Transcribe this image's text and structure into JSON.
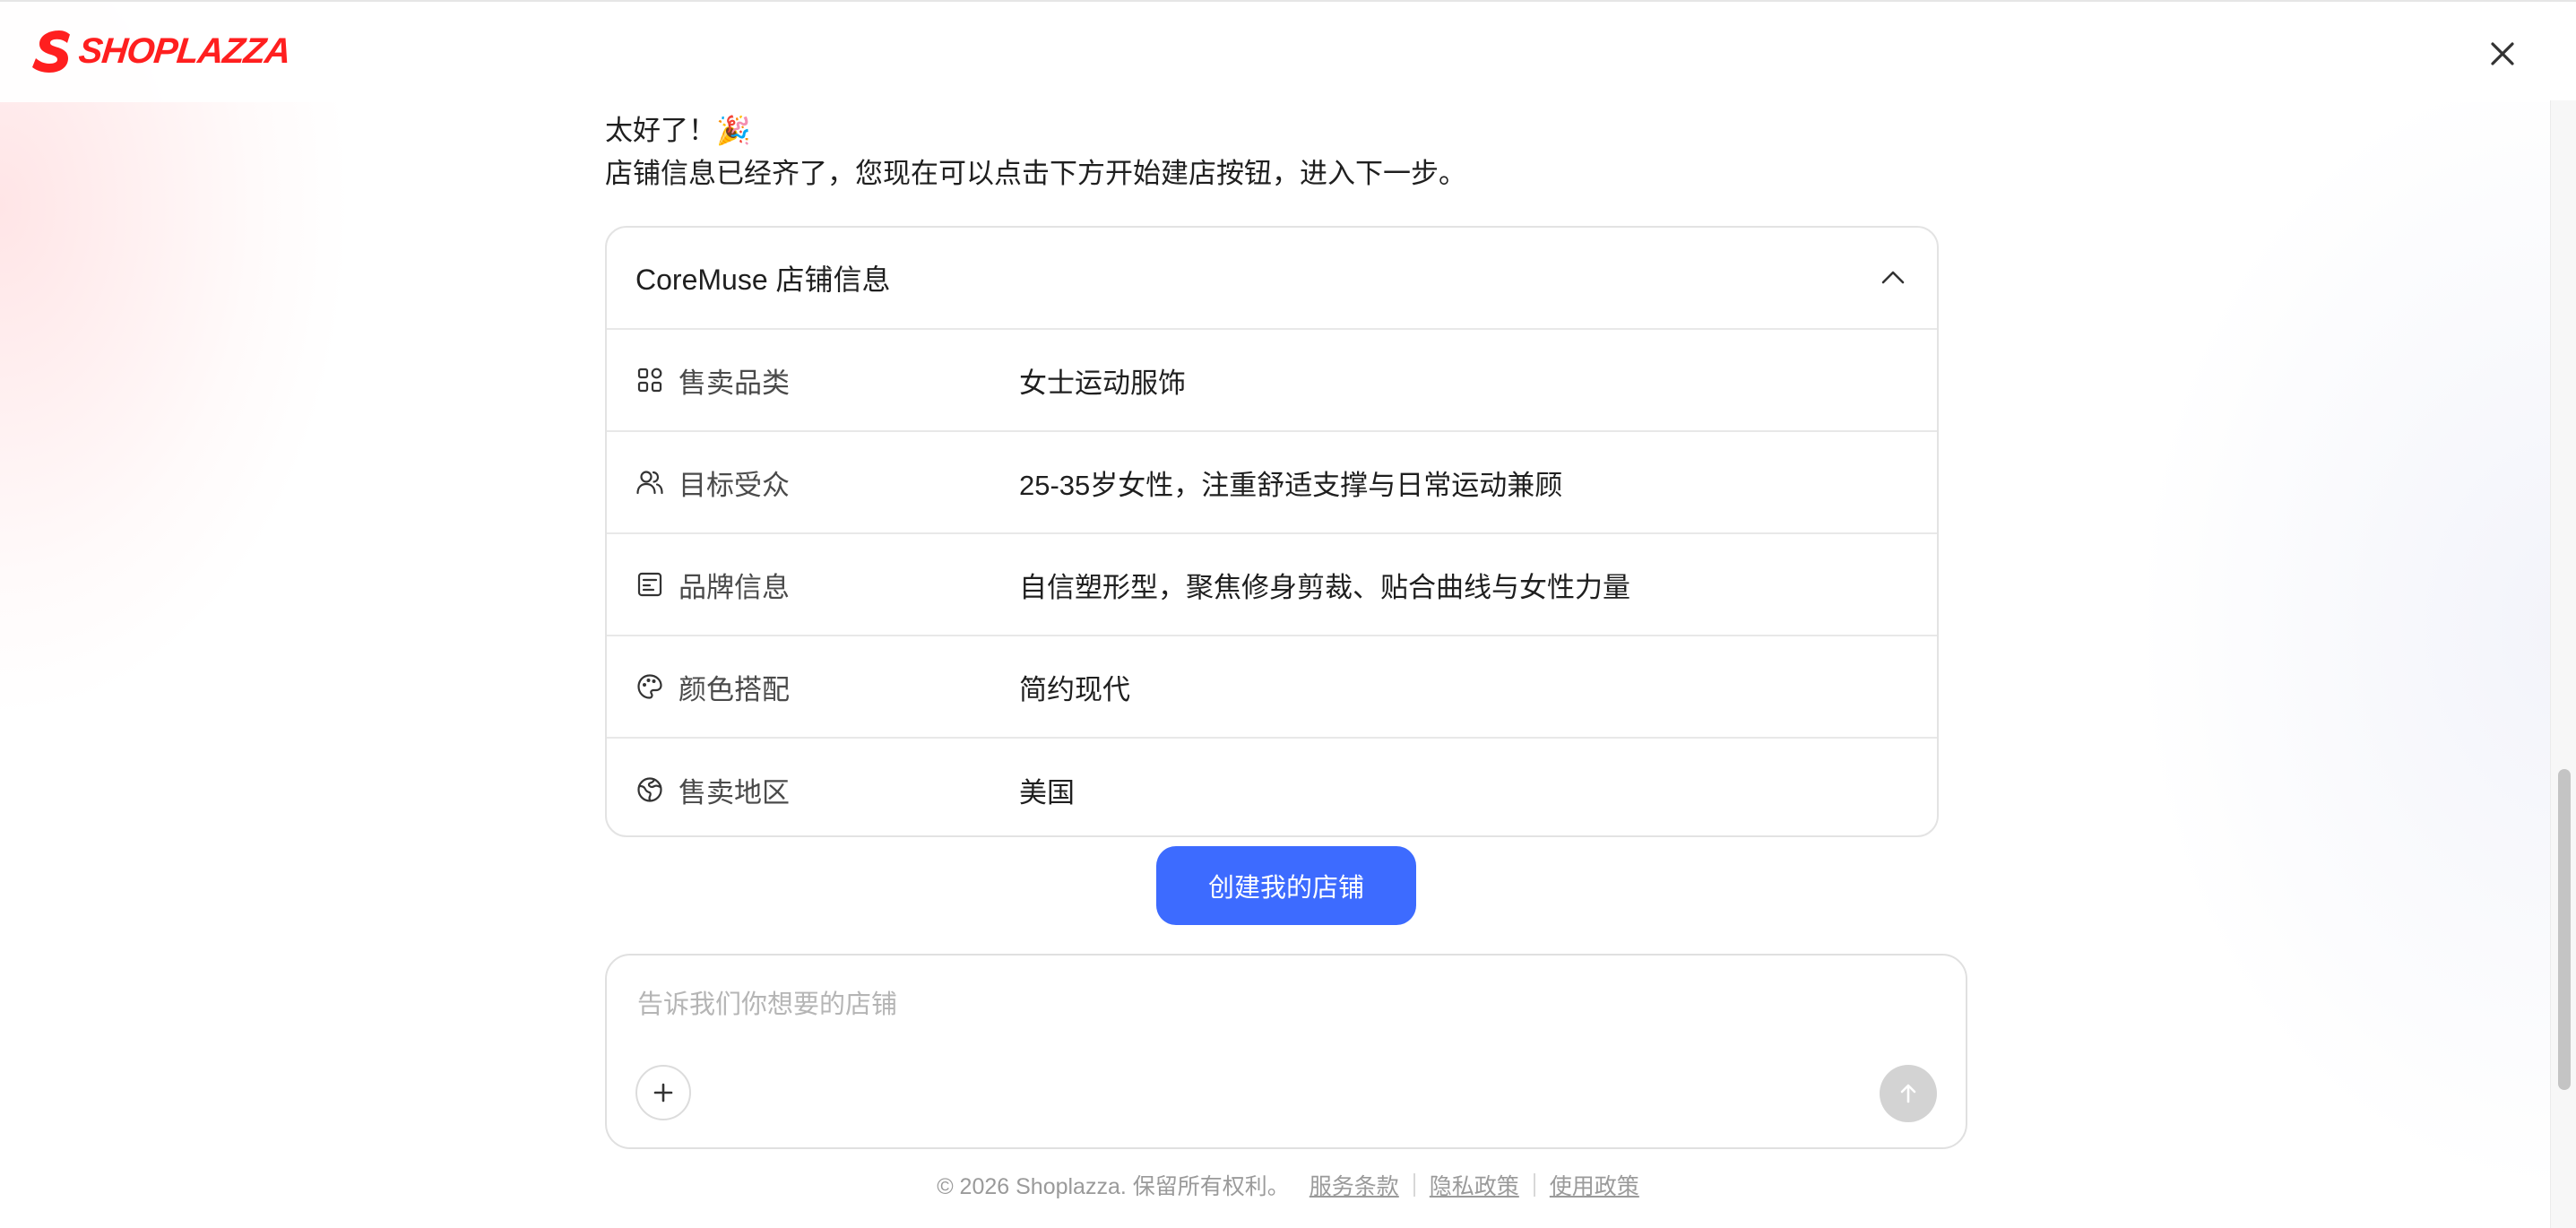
{
  "app": {
    "brand": "SHOPLAZZA",
    "brand_color": "#ff1f1f",
    "accent_color": "#3d6bff"
  },
  "messages": [
    {
      "text": "太好了！🎉"
    },
    {
      "text": "店铺信息已经齐了，您现在可以点击下方开始建店按钮，进入下一步。"
    }
  ],
  "store_card": {
    "title": "CoreMuse 店铺信息",
    "collapse_icon": "chevron-up-icon",
    "rows": [
      {
        "icon": "category-icon",
        "label": "售卖品类",
        "value": "女士运动服饰"
      },
      {
        "icon": "users-icon",
        "label": "目标受众",
        "value": "25-35岁女性，注重舒适支撑与日常运动兼顾"
      },
      {
        "icon": "brand-icon",
        "label": "品牌信息",
        "value": "自信塑形型，聚焦修身剪裁、贴合曲线与女性力量"
      },
      {
        "icon": "palette-icon",
        "label": "颜色搭配",
        "value": "简约现代"
      },
      {
        "icon": "globe-icon",
        "label": "售卖地区",
        "value": "美国"
      }
    ]
  },
  "create_button": {
    "label": "创建我的店铺"
  },
  "composer": {
    "value": "",
    "placeholder": "告诉我们你想要的店铺",
    "attach_icon": "plus-icon",
    "send_icon": "arrow-up-icon"
  },
  "footer": {
    "copyright": "© 2026 Shoplazza. 保留所有权利。",
    "links": [
      "服务条款",
      "隐私政策",
      "使用政策"
    ]
  }
}
